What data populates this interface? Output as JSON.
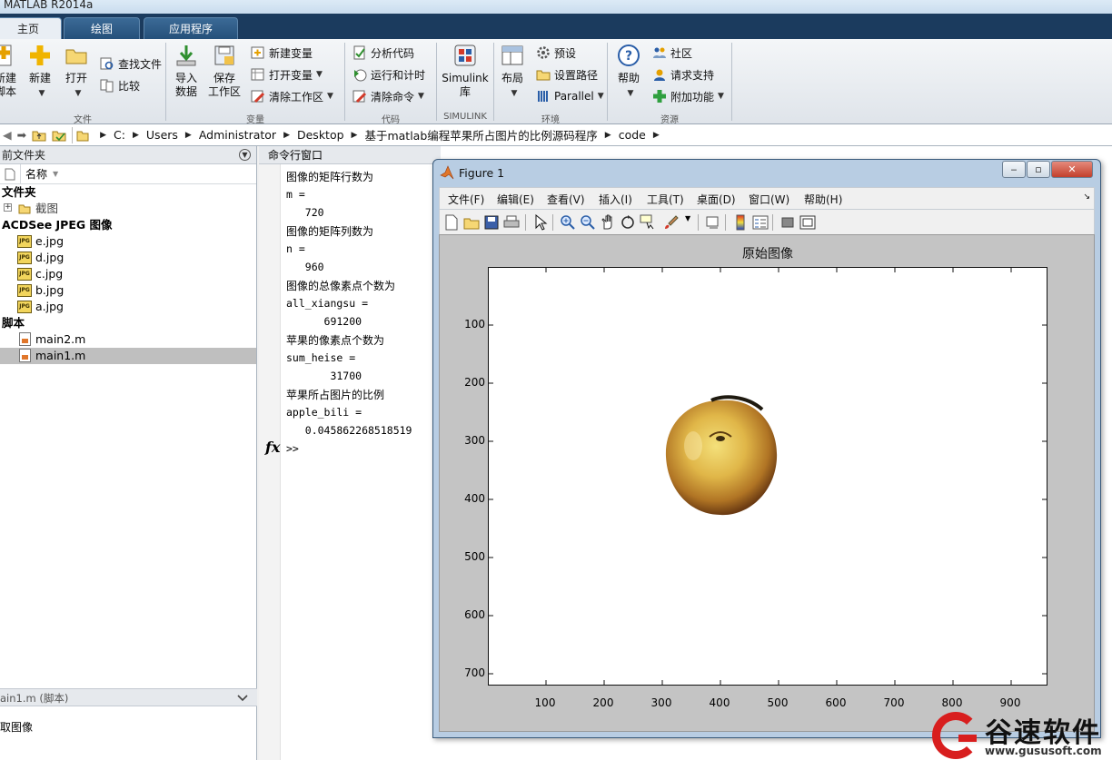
{
  "app": {
    "title": "MATLAB R2014a"
  },
  "tabs": [
    {
      "label": "主页",
      "active": true
    },
    {
      "label": "绘图",
      "active": false
    },
    {
      "label": "应用程序",
      "active": false
    }
  ],
  "ribbon": {
    "file_group": {
      "label": "文件",
      "new_script": "新建\n脚本",
      "new": "新建",
      "open": "打开",
      "find_files": "查找文件",
      "compare": "比较"
    },
    "variable_group": {
      "label": "变量",
      "import_data": "导入\n数据",
      "save_workspace": "保存\n工作区",
      "new_variable": "新建变量",
      "open_variable": "打开变量",
      "clear_workspace": "清除工作区"
    },
    "code_group": {
      "label": "代码",
      "analyze_code": "分析代码",
      "run_and_time": "运行和计时",
      "clear_commands": "清除命令"
    },
    "simulink_group": {
      "label": "SIMULINK",
      "simulink_library": "Simulink\n库"
    },
    "environment_group": {
      "label": "环境",
      "layout": "布局",
      "preferences": "预设",
      "set_path": "设置路径",
      "parallel": "Parallel"
    },
    "resources_group": {
      "label": "资源",
      "help": "帮助",
      "community": "社区",
      "request_support": "请求支持",
      "add_ons": "附加功能"
    }
  },
  "address": {
    "path": [
      "C:",
      "Users",
      "Administrator",
      "Desktop",
      "基于matlab编程苹果所占图片的比例源码程序",
      "code"
    ]
  },
  "file_panel": {
    "title": "前文件夹",
    "column_name": "名称",
    "groups": [
      {
        "category": "文件夹",
        "items": [
          {
            "name": "截图",
            "type": "folder"
          }
        ]
      },
      {
        "category": "ACDSee JPEG 图像",
        "items": [
          {
            "name": "e.jpg",
            "type": "jpg"
          },
          {
            "name": "d.jpg",
            "type": "jpg"
          },
          {
            "name": "c.jpg",
            "type": "jpg"
          },
          {
            "name": "b.jpg",
            "type": "jpg"
          },
          {
            "name": "a.jpg",
            "type": "jpg"
          }
        ]
      },
      {
        "category": "脚本",
        "items": [
          {
            "name": "main2.m",
            "type": "m"
          },
          {
            "name": "main1.m",
            "type": "m",
            "selected": true
          }
        ]
      }
    ],
    "details_title": "ain1.m (脚本)",
    "details_text": "取图像"
  },
  "command_window": {
    "title": "命令行窗口",
    "lines": [
      {
        "text": "图像的矩阵行数为",
        "kind": "zh"
      },
      {
        "text": "m =",
        "kind": "code"
      },
      {
        "text": "   720",
        "kind": "code"
      },
      {
        "text": "图像的矩阵列数为",
        "kind": "zh"
      },
      {
        "text": "n =",
        "kind": "code"
      },
      {
        "text": "   960",
        "kind": "code"
      },
      {
        "text": "图像的总像素点个数为",
        "kind": "zh"
      },
      {
        "text": "all_xiangsu =",
        "kind": "code"
      },
      {
        "text": "      691200",
        "kind": "code"
      },
      {
        "text": "苹果的像素点个数为",
        "kind": "zh"
      },
      {
        "text": "sum_heise =",
        "kind": "code"
      },
      {
        "text": "       31700",
        "kind": "code"
      },
      {
        "text": "苹果所占图片的比例",
        "kind": "zh"
      },
      {
        "text": "apple_bili =",
        "kind": "code"
      },
      {
        "text": "   0.045862268518519",
        "kind": "code"
      }
    ],
    "fx_label": "fx",
    "prompt": ">>"
  },
  "figure": {
    "title": "Figure 1",
    "menu": [
      "文件(F)",
      "编辑(E)",
      "查看(V)",
      "插入(I)",
      "工具(T)",
      "桌面(D)",
      "窗口(W)",
      "帮助(H)"
    ],
    "toolbar_icons": [
      "new-figure-icon",
      "open-icon",
      "save-icon",
      "print-icon",
      "pointer-icon",
      "zoom-in-icon",
      "zoom-out-icon",
      "pan-icon",
      "rotate-icon",
      "data-cursor-icon",
      "brush-icon",
      "link-icon",
      "colorbar-icon",
      "legend-icon",
      "hide-plot-tools-icon",
      "show-plot-tools-icon"
    ],
    "axes_title": "原始图像",
    "x_ticks": [
      "100",
      "200",
      "300",
      "400",
      "500",
      "600",
      "700",
      "800",
      "900"
    ],
    "y_ticks": [
      "100",
      "200",
      "300",
      "400",
      "500",
      "600",
      "700"
    ],
    "x_range": [
      0.5,
      960.5
    ],
    "y_range": [
      0.5,
      720.5
    ]
  },
  "watermark": {
    "brand": "谷速软件",
    "url": "www.gususoft.com"
  }
}
